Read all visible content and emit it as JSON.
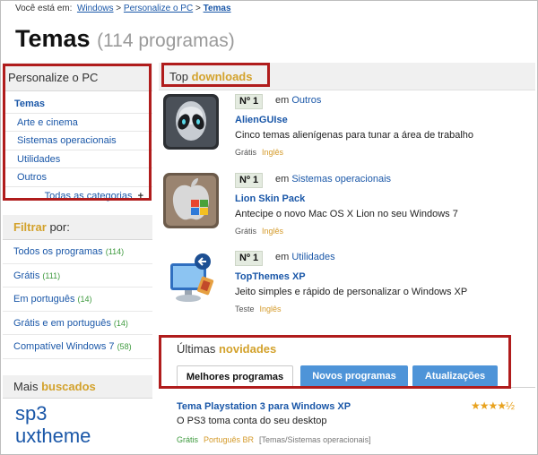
{
  "breadcrumb": {
    "prefix": "Você está em:",
    "item1": "Windows",
    "sep": ">",
    "item2": "Personalize o PC",
    "current": "Temas"
  },
  "page": {
    "title": "Temas",
    "count": "(114 programas)"
  },
  "sidebar": {
    "title": "Personalize o PC",
    "items": [
      {
        "label": "Temas"
      },
      {
        "label": "Arte e cinema"
      },
      {
        "label": "Sistemas operacionais"
      },
      {
        "label": "Utilidades"
      },
      {
        "label": "Outros"
      }
    ],
    "all_label": "Todas as categorias",
    "all_icon": "+"
  },
  "filter": {
    "title_accent": "Filtrar",
    "title_rest": " por:",
    "items": [
      {
        "label": "Todos os programas",
        "count": "(114)"
      },
      {
        "label": "Grátis",
        "count": "(111)"
      },
      {
        "label": "Em português",
        "count": "(14)"
      },
      {
        "label": "Grátis e em português",
        "count": "(14)"
      },
      {
        "label": "Compatível Windows 7",
        "count": "(58)"
      }
    ]
  },
  "mais": {
    "title_plain": "Mais ",
    "title_accent": "buscados",
    "terms": [
      "sp3",
      "uxtheme"
    ]
  },
  "top": {
    "title_plain": "Top ",
    "title_accent": "downloads",
    "items": [
      {
        "rank": "Nº 1",
        "em": "em",
        "category": "Outros",
        "name": "AlienGUIse",
        "desc": "Cinco temas alienígenas para tunar a área de trabalho",
        "license": "Grátis",
        "lang": "Inglês",
        "icon": "alien-icon"
      },
      {
        "rank": "Nº 1",
        "em": "em",
        "category": "Sistemas operacionais",
        "name": "Lion Skin Pack",
        "desc": "Antecipe o novo Mac OS X Lion no seu Windows 7",
        "license": "Grátis",
        "lang": "Inglês",
        "icon": "apple-windows-icon"
      },
      {
        "rank": "Nº 1",
        "em": "em",
        "category": "Utilidades",
        "name": "TopThemes XP",
        "desc": "Jeito simples e rápido de personalizar o Windows XP",
        "license": "Teste",
        "lang": "Inglês",
        "icon": "computer-paint-icon"
      }
    ]
  },
  "ultimas": {
    "title_plain": "Últimas ",
    "title_accent": "novidades",
    "tabs": [
      "Melhores programas",
      "Novos programas",
      "Atualizações"
    ],
    "active_tab": 0,
    "entry": {
      "name": "Tema Playstation 3 para Windows XP",
      "desc": "O PS3 toma conta do seu desktop",
      "license": "Grátis",
      "lang": "Português BR",
      "path": "[Temas/Sistemas operacionais]",
      "rating": 4.5,
      "stars": "★★★★½"
    }
  },
  "colors": {
    "link": "#1a57a8",
    "accent": "#d3a22c",
    "highlight_border": "#b01c1c",
    "tab_blue": "#4e94d8"
  }
}
